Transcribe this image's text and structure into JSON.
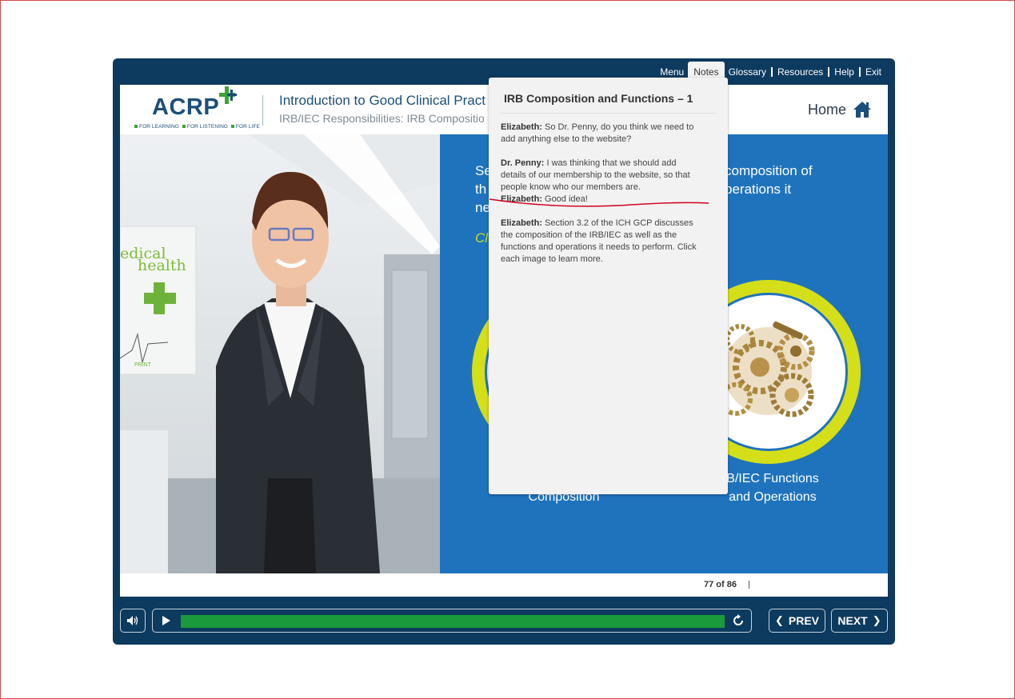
{
  "nav": {
    "items": [
      "Menu",
      "Notes",
      "Glossary",
      "Resources",
      "Help",
      "Exit"
    ],
    "active": "Notes"
  },
  "header": {
    "logo_text": "ACRP",
    "logo_tagline": [
      "FOR LEARNING",
      "FOR LISTENING",
      "FOR LIFE"
    ],
    "course_title": "Introduction to Good Clinical Pract",
    "course_subtitle": "IRB/IEC Responsibilities: IRB Compositio",
    "home_label": "Home"
  },
  "stage": {
    "text_left_lines": [
      "Se",
      "th",
      "ne"
    ],
    "text_right_lines": [
      "composition of",
      "perations it"
    ],
    "click_fragment": "Cl",
    "photo_sign": [
      "edical",
      "health"
    ],
    "photo_print": "PRINT",
    "left_image_label_line2": "Composition",
    "right_image_label_line1": "B/IEC Functions",
    "right_image_label_line2": "and Operations"
  },
  "footer": {
    "page_counter": "77 of 86"
  },
  "controls": {
    "prev_label": "PREV",
    "next_label": "NEXT",
    "progress": 1.0
  },
  "notes": {
    "title": "IRB Composition and Functions – 1",
    "entries": [
      {
        "speaker": "Elizabeth:",
        "text": " So Dr. Penny, do you think we need to add anything else to the website?"
      },
      {
        "speaker": "Dr. Penny:",
        "text": " I was thinking that we should add details of our membership to the website, so that people know who our members are."
      },
      {
        "speaker": "Elizabeth:",
        "text": " Good idea!"
      },
      {
        "speaker": "Elizabeth:",
        "text": " Section 3.2 of the ICH GCP discusses the composition of the IRB/IEC as well as the functions and operations it needs to perform. Click each image to learn more."
      }
    ]
  },
  "colors": {
    "frame": "#0d3a5f",
    "panel_blue": "#1f73bc",
    "accent_green": "#1a9a3a",
    "ring_yellow": "#d4df1a",
    "annotation_red": "#d0021b"
  }
}
